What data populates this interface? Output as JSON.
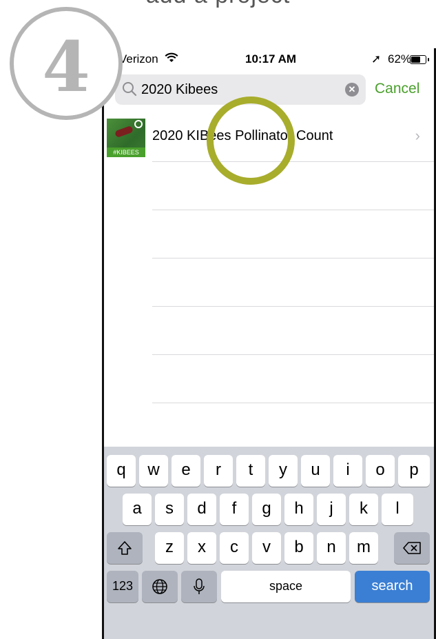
{
  "caption": "add a project",
  "step_number": "4",
  "status_bar": {
    "carrier": "Verizon",
    "time": "10:17 AM",
    "battery": "62%",
    "icons": [
      "wifi-icon",
      "location-arrow-icon",
      "battery-icon"
    ]
  },
  "search": {
    "value": "2020 Kibees",
    "cancel_label": "Cancel",
    "accent_color": "#4aa02c"
  },
  "results": [
    {
      "title": "2020 KIBees Pollinator Count",
      "thumb_tag": "#KIBEES"
    }
  ],
  "keyboard": {
    "row1": [
      "q",
      "w",
      "e",
      "r",
      "t",
      "y",
      "u",
      "i",
      "o",
      "p"
    ],
    "row2": [
      "a",
      "s",
      "d",
      "f",
      "g",
      "h",
      "j",
      "k",
      "l"
    ],
    "row3": [
      "z",
      "x",
      "c",
      "v",
      "b",
      "n",
      "m"
    ],
    "numbers_label": "123",
    "space_label": "space",
    "search_label": "search"
  },
  "colors": {
    "highlight_circle": "#a8ad2c",
    "search_key": "#3b7fd4"
  }
}
